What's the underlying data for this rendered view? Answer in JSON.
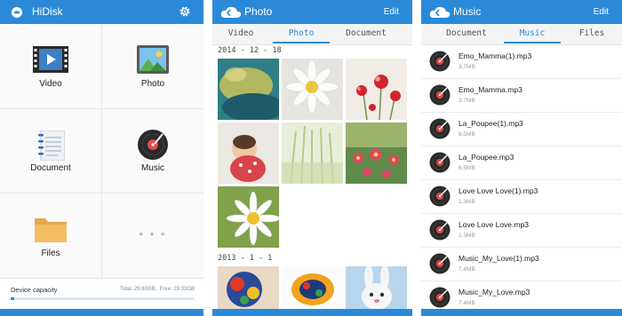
{
  "hidisk": {
    "title": "HiDisk",
    "grid": {
      "video": "Video",
      "photo": "Photo",
      "document": "Document",
      "music": "Music",
      "files": "Files",
      "more": "• • •"
    },
    "capacity": {
      "label": "Device capacity",
      "total": "Total: 29.80GB",
      "free": "Free: 29.33GB",
      "used_fraction": 0.02
    }
  },
  "photo_screen": {
    "title": "Photo",
    "edit": "Edit",
    "tabs": [
      "Video",
      "Photo",
      "Document"
    ],
    "active_tab": 1,
    "groups": [
      {
        "date": "2014 - 12 - 18"
      },
      {
        "date": "2013 - 1 - 1"
      }
    ]
  },
  "music_screen": {
    "title": "Music",
    "edit": "Edit",
    "tabs": [
      "Document",
      "Music",
      "Files"
    ],
    "active_tab": 1,
    "files": [
      {
        "name": "Emo_Mamma(1).mp3",
        "size": "3.7MB"
      },
      {
        "name": "Emo_Mamma.mp3",
        "size": "3.7MB"
      },
      {
        "name": "La_Poupee(1).mp3",
        "size": "6.5MB"
      },
      {
        "name": "La_Poupee.mp3",
        "size": "6.5MB"
      },
      {
        "name": "Love Love Love(1).mp3",
        "size": "1.3MB"
      },
      {
        "name": "Love Love Love.mp3",
        "size": "1.3MB"
      },
      {
        "name": "Music_My_Love(1).mp3",
        "size": "7.4MB"
      },
      {
        "name": "Music_My_Love.mp3",
        "size": "7.4MB"
      }
    ]
  },
  "colors": {
    "accent": "#2b8ad8",
    "disc": "#2a2a2a",
    "disc_needle": "#e24a4a"
  },
  "icons": {
    "app": "hidisk-logo-icon",
    "settings": "gear-icon",
    "back": "cloud-back-icon",
    "video": "film-icon",
    "photo": "picture-icon",
    "document": "notebook-icon",
    "music": "vinyl-icon",
    "files": "folder-icon"
  }
}
